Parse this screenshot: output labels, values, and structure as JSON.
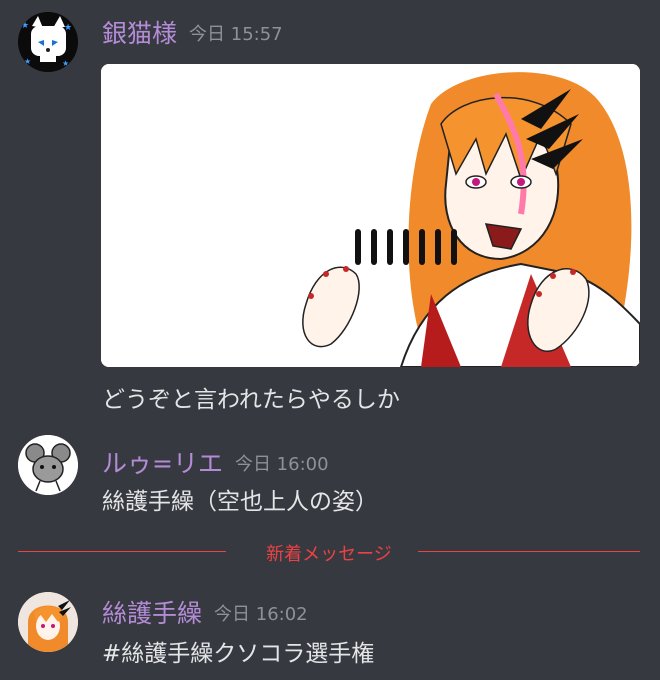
{
  "messages": [
    {
      "username": "銀猫様",
      "timestamp": "今日 15:57",
      "avatar_icon": "white-cat-avatar",
      "attachment": "image-attachment-orange-haired-character",
      "text": "どうぞと言われたらやるしか"
    },
    {
      "username": "ルゥ=リエ",
      "timestamp": "今日 16:00",
      "avatar_icon": "gray-mouse-avatar",
      "text": "絲護手繰（空也上人の姿）"
    },
    {
      "username": "絲護手繰",
      "timestamp": "今日 16:02",
      "avatar_icon": "orange-haired-character-avatar",
      "text": "#絲護手繰クソコラ選手権"
    }
  ],
  "divider": {
    "label": "新着メッセージ",
    "color": "#ed4245"
  },
  "colors": {
    "background": "#36393f",
    "username": "#b48bd6",
    "timestamp": "#8e9297",
    "text": "#e4e5e7",
    "hair": "#f08a2a"
  }
}
